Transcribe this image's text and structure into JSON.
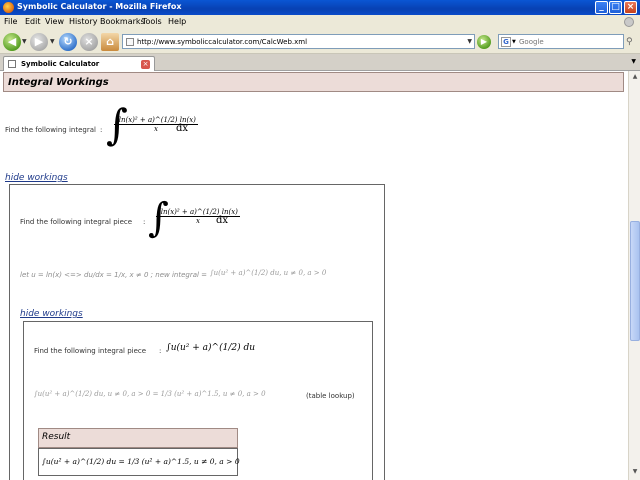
{
  "window": {
    "title": "Symbolic Calculator - Mozilla Firefox",
    "minimize": "_",
    "maximize": "□",
    "close": "×"
  },
  "menu": [
    "File",
    "Edit",
    "View",
    "History",
    "Bookmarks",
    "Tools",
    "Help"
  ],
  "nav": {
    "url": "http://www.symboliccalculator.com/CalcWeb.xml",
    "search_placeholder": "Google"
  },
  "tab": {
    "label": "Symbolic Calculator"
  },
  "page": {
    "header": "Integral Workings",
    "main_prompt": "Find the following integral",
    "main_integrand_num": "(ln(x)² + a)^(1/2) ln(x)",
    "main_integrand_den": "x",
    "dx": "dx",
    "hide_workings_1": "hide workings",
    "piece_prompt": "Find the following integral  piece",
    "substitution": "let  u = ln(x)  <=>  du/dx = 1/x,  x ≠ 0  ;  new integral =",
    "new_integral": "∫u(u² + a)^(1/2) du,  u ≠ 0,  a > 0",
    "hide_workings_2": "hide workings",
    "piece_prompt_2": "Find the following integral  piece",
    "inner_integral": "∫u(u² + a)^(1/2) du",
    "lookup_lhs": "∫u(u² + a)^(1/2) du,  u ≠ 0,  a > 0  =  1/3 (u² + a)^1.5,  u ≠ 0,  a > 0",
    "lookup_note": "(table lookup)",
    "result_label": "Result",
    "result_expr": "∫u(u² + a)^(1/2) du = 1/3 (u² + a)^1.5,  u ≠ 0,  a > 0"
  }
}
